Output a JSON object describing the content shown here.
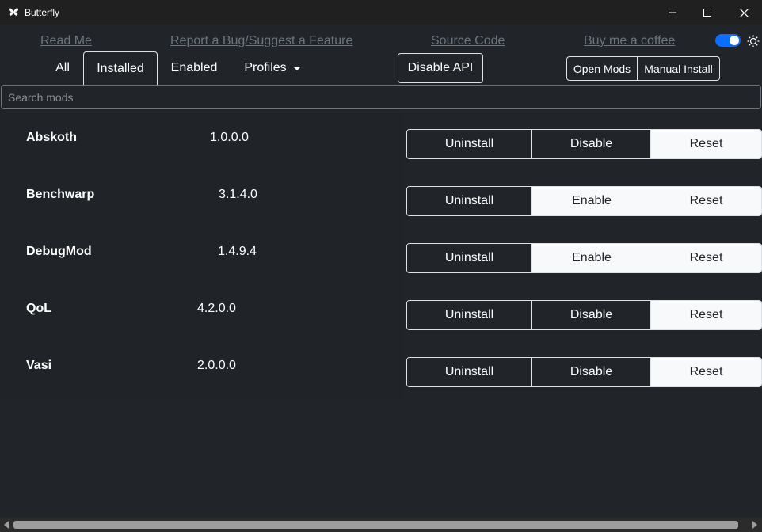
{
  "window": {
    "title": "Butterfly",
    "icon": "butterfly-icon"
  },
  "links": {
    "read_me": "Read Me",
    "report_bug": "Report a Bug/Suggest a Feature",
    "source_code": "Source Code",
    "buy_coffee": "Buy me a coffee"
  },
  "theme_toggle": {
    "on": true,
    "icon": "sun-icon"
  },
  "tabs": {
    "all": "All",
    "installed": "Installed",
    "enabled": "Enabled",
    "profiles": "Profiles",
    "active": "Installed"
  },
  "buttons": {
    "disable_api": "Disable API",
    "open_mods": "Open Mods",
    "manual_install": "Manual Install"
  },
  "search": {
    "placeholder": "Search mods"
  },
  "mods": [
    {
      "name": "Abskoth",
      "version": "1.0.0.0",
      "uninstall": "Uninstall",
      "toggle": "Disable",
      "reset": "Reset"
    },
    {
      "name": "Benchwarp",
      "version": "3.1.4.0",
      "uninstall": "Uninstall",
      "toggle": "Enable",
      "reset": "Reset"
    },
    {
      "name": "DebugMod",
      "version": "1.4.9.4",
      "uninstall": "Uninstall",
      "toggle": "Enable",
      "reset": "Reset"
    },
    {
      "name": "QoL",
      "version": "4.2.0.0",
      "uninstall": "Uninstall",
      "toggle": "Disable",
      "reset": "Reset"
    },
    {
      "name": "Vasi",
      "version": "2.0.0.0",
      "uninstall": "Uninstall",
      "toggle": "Disable",
      "reset": "Reset"
    }
  ],
  "colors": {
    "accent": "#0d6efd",
    "background": "#212529"
  }
}
